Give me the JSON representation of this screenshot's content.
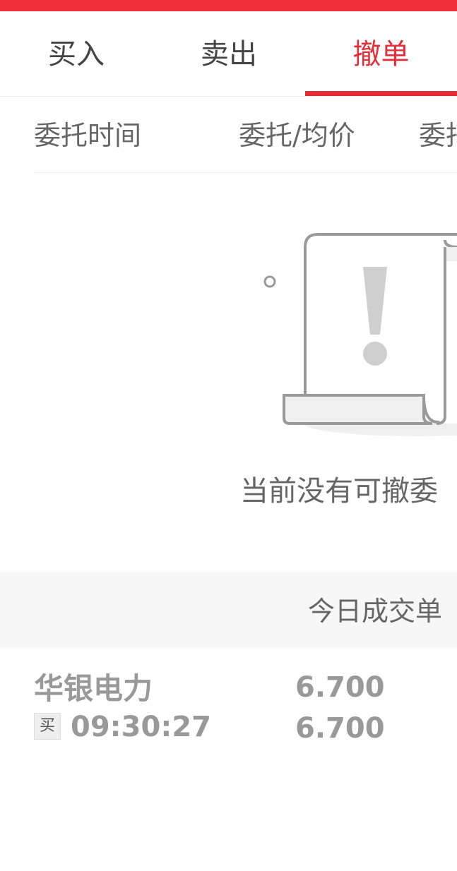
{
  "tabs": [
    {
      "label": "买入",
      "active": false
    },
    {
      "label": "卖出",
      "active": false
    },
    {
      "label": "撤单",
      "active": true
    }
  ],
  "colors": {
    "accent": "#e52e37",
    "top_bar": "#f02f3a"
  },
  "columns": {
    "time": "委托时间",
    "price": "委托/均价",
    "more": "委托"
  },
  "empty_state": {
    "icon": "warning-document-icon",
    "message": "当前没有可撤委"
  },
  "today_trades": {
    "title": "今日成交单",
    "rows": [
      {
        "name": "华银电力",
        "side": "买",
        "time": "09:30:27",
        "price": "6.700",
        "avg_price": "6.700"
      }
    ]
  }
}
